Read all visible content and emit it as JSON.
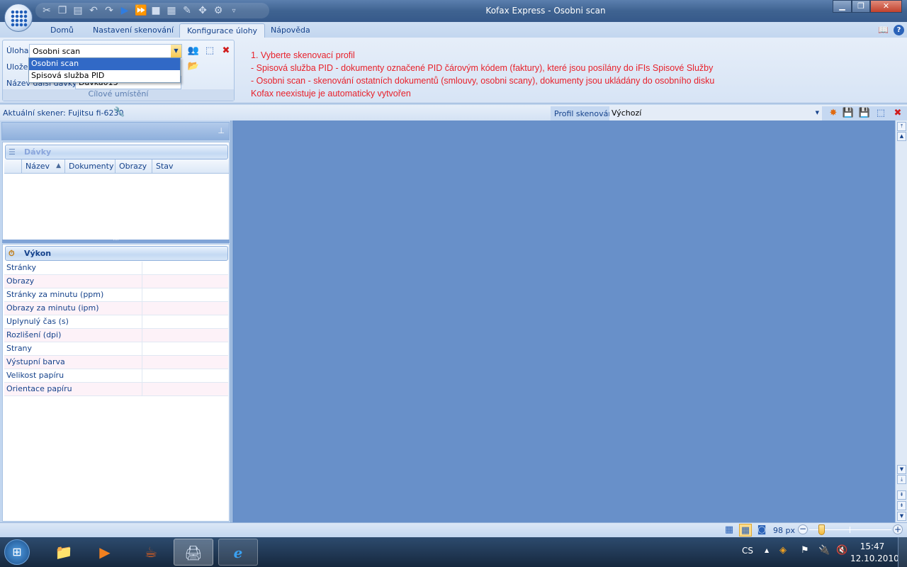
{
  "window": {
    "title": "Kofax Express - Osobni scan",
    "minimize": "▁",
    "maximize": "❐",
    "close": "✕"
  },
  "qat": {
    "icons": [
      "cut-icon",
      "copy-icon",
      "paste-icon",
      "undo-icon",
      "redo-icon",
      "scan-icon",
      "scan-all-icon",
      "stop-icon",
      "batch-icon",
      "export-icon",
      "settings-icon",
      "gear-icon"
    ]
  },
  "tabs": [
    {
      "label": "Domů"
    },
    {
      "label": "Nastavení skenování"
    },
    {
      "label": "Konfigurace úlohy",
      "active": true
    },
    {
      "label": "Nápověda"
    }
  ],
  "ribbon": {
    "task_label": "Úloha",
    "task_value": "Osobni scan",
    "save_label": "Uložen",
    "next_batch_label": "Název další dávky",
    "next_batch_value": "Davka013",
    "group_label": "Cílové umístění",
    "dropdown_options": [
      "Osobni scan",
      "Spisová služba PID"
    ],
    "instructions": [
      "1. Vyberte skenovací profil",
      "- Spisová služba PID - dokumenty označené PID čárovým kódem (faktury), které jsou posílány do iFIs Spisové Služby",
      "- Osobni scan - skenování ostatních dokumentů (smlouvy, osobni scany), dokumenty jsou ukládány do osobního disku",
      "Kofax neexistuje je automaticky vytvořen"
    ]
  },
  "scanner": {
    "label": "Aktuální skener: Fujitsu fi-6230"
  },
  "profile": {
    "label": "Profil skenování",
    "value": "Výchozí"
  },
  "batches": {
    "title": "Dávky",
    "columns": [
      "Název",
      "Dokumenty",
      "Obrazy",
      "Stav"
    ],
    "sort_indicator": "▲"
  },
  "performance": {
    "title": "Výkon",
    "rows": [
      "Stránky",
      "Obrazy",
      "Stránky za minutu (ppm)",
      "Obrazy za minutu (ipm)",
      "Uplynulý čas (s)",
      "Rozlišení (dpi)",
      "Strany",
      "Výstupní barva",
      "Velikost papíru",
      "Orientace papíru"
    ]
  },
  "statusbar": {
    "zoom_label": "98 px",
    "zoom_fraction": 0.15
  },
  "taskbar": {
    "lang": "CS",
    "time": "15:47",
    "date": "12.10.2010"
  },
  "colors": {
    "instructions": "#e8212b",
    "main_bg": "#6890c9"
  }
}
